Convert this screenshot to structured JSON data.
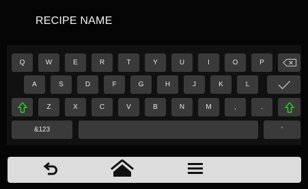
{
  "field": {
    "label": "RECIPE NAME"
  },
  "keyboard": {
    "row1": [
      "Q",
      "W",
      "E",
      "R",
      "T",
      "Y",
      "U",
      "I",
      "O",
      "P"
    ],
    "row2": [
      "A",
      "S",
      "D",
      "F",
      "G",
      "H",
      "J",
      "K",
      "L"
    ],
    "row3": [
      "Z",
      "X",
      "C",
      "V",
      "B",
      "N",
      "M",
      ",",
      "."
    ],
    "mode_key": "&123",
    "quote_key": "'",
    "icons": {
      "backspace": "backspace-icon",
      "enter": "checkmark-icon",
      "shift": "shift-arrow-icon"
    },
    "shift_color": "#2ecc2e"
  },
  "nav": {
    "icons": [
      "back-arrow-icon",
      "home-icon",
      "menu-icon"
    ]
  }
}
